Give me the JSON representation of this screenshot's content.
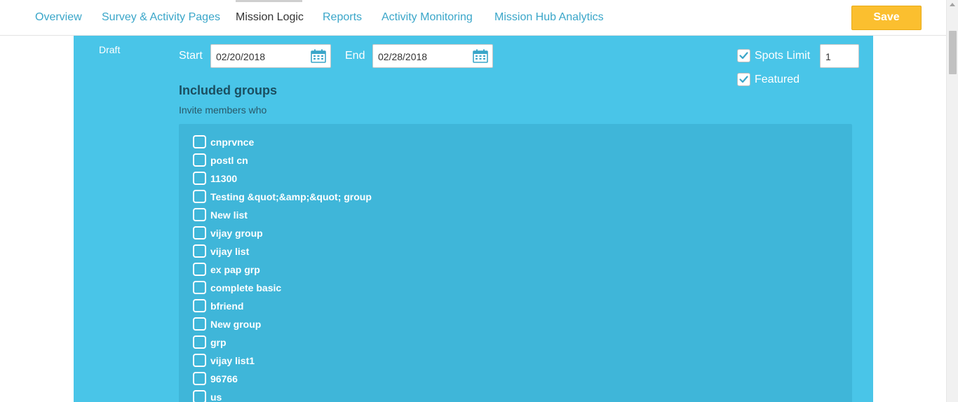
{
  "nav": {
    "tabs": [
      {
        "label": "Overview"
      },
      {
        "label": "Survey & Activity Pages"
      },
      {
        "label": "Mission Logic"
      },
      {
        "label": "Reports"
      },
      {
        "label": "Activity Monitoring"
      },
      {
        "label": "Mission Hub Analytics"
      }
    ],
    "active_tab": "Mission Logic",
    "save_label": "Save"
  },
  "status": {
    "label": "Draft"
  },
  "dates": {
    "start_label": "Start",
    "start_value": "02/20/2018",
    "end_label": "End",
    "end_value": "02/28/2018"
  },
  "options": {
    "spots_limit_label": "Spots Limit",
    "spots_limit_checked": true,
    "spots_limit_value": "1",
    "featured_label": "Featured",
    "featured_checked": true
  },
  "groups": {
    "title": "Included groups",
    "subtitle": "Invite members who",
    "items": [
      {
        "label": "cnprvnce",
        "checked": false
      },
      {
        "label": "postl cn",
        "checked": false
      },
      {
        "label": "11300",
        "checked": false
      },
      {
        "label": "Testing &quot;&amp;&quot; group",
        "checked": false
      },
      {
        "label": "New list",
        "checked": false
      },
      {
        "label": "vijay group",
        "checked": false
      },
      {
        "label": "vijay list",
        "checked": false
      },
      {
        "label": "ex pap grp",
        "checked": false
      },
      {
        "label": "complete basic",
        "checked": false
      },
      {
        "label": "bfriend",
        "checked": false
      },
      {
        "label": "New group",
        "checked": false
      },
      {
        "label": "grp",
        "checked": false
      },
      {
        "label": "vijay list1",
        "checked": false
      },
      {
        "label": "96766",
        "checked": false
      },
      {
        "label": "us",
        "checked": false
      }
    ]
  },
  "colors": {
    "accent": "#3aa6c9",
    "panel": "#49c5e8",
    "save": "#fbbf2f"
  }
}
